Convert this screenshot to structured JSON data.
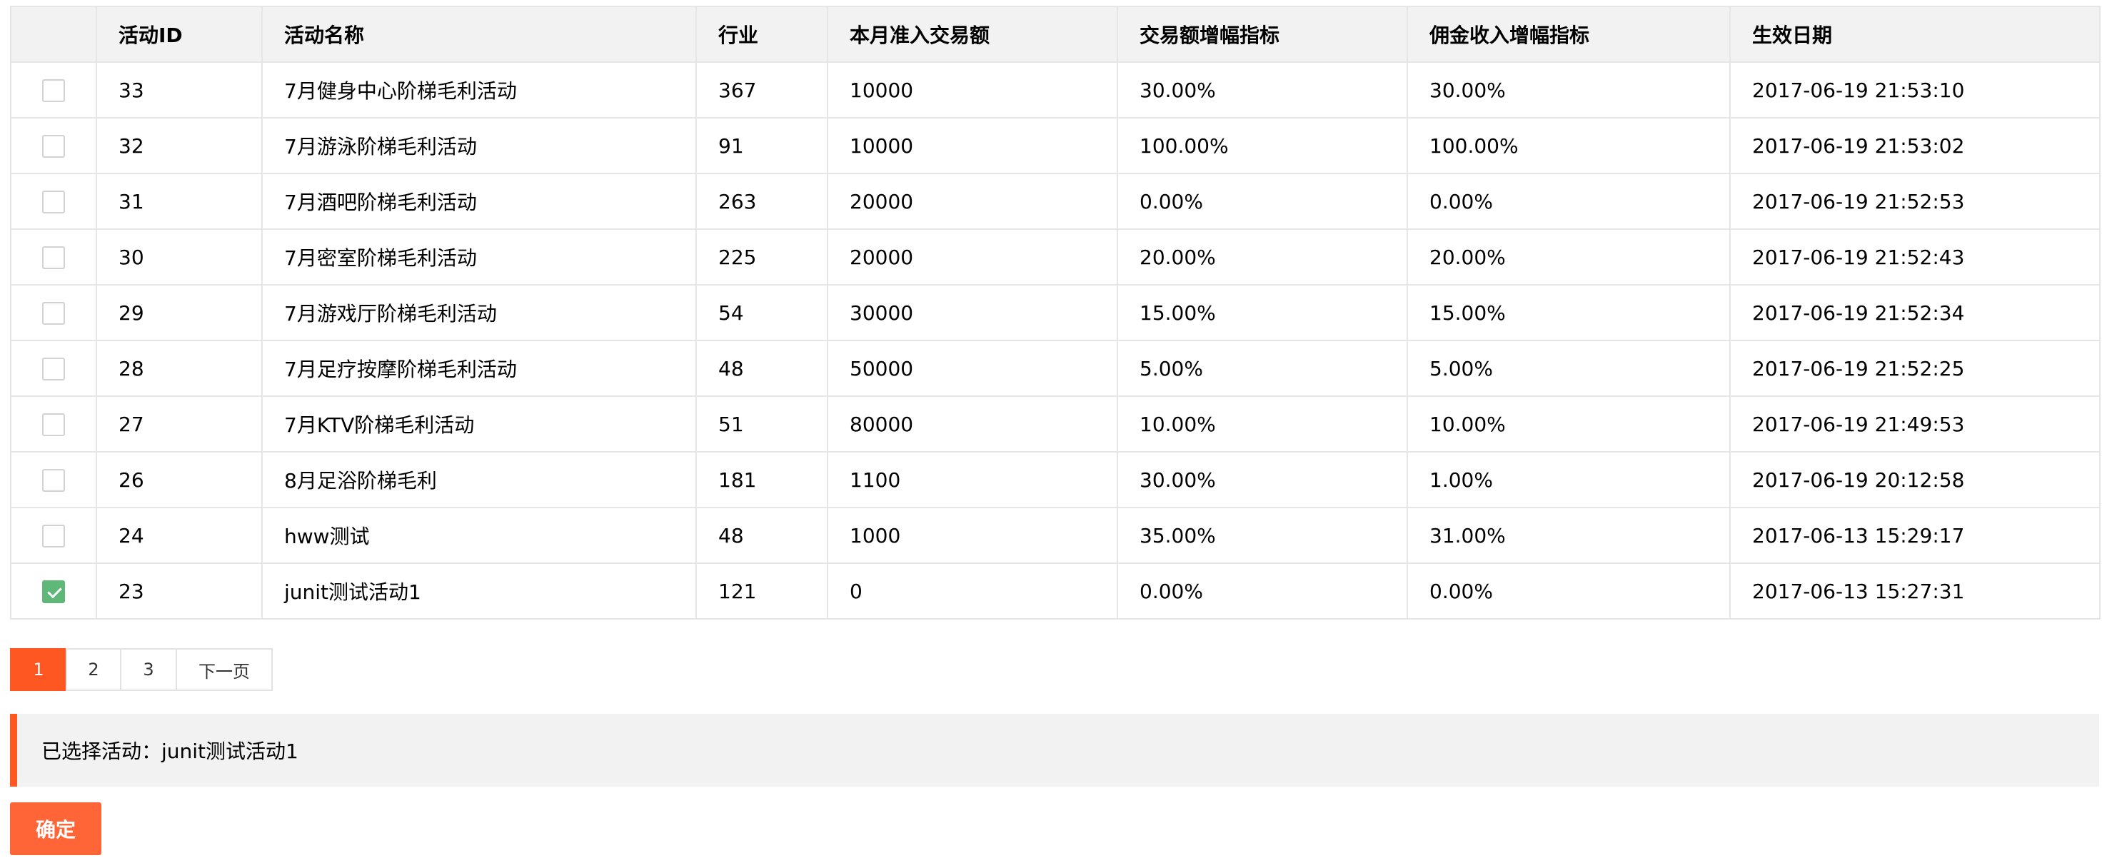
{
  "table": {
    "columns": [
      "活动ID",
      "活动名称",
      "行业",
      "本月准入交易额",
      "交易额增幅指标",
      "佣金收入增幅指标",
      "生效日期"
    ],
    "rows": [
      {
        "checked": false,
        "cells": [
          "33",
          "7月健身中心阶梯毛利活动",
          "367",
          "10000",
          "30.00%",
          "30.00%",
          "2017-06-19 21:53:10"
        ]
      },
      {
        "checked": false,
        "cells": [
          "32",
          "7月游泳阶梯毛利活动",
          "91",
          "10000",
          "100.00%",
          "100.00%",
          "2017-06-19 21:53:02"
        ]
      },
      {
        "checked": false,
        "cells": [
          "31",
          "7月酒吧阶梯毛利活动",
          "263",
          "20000",
          "0.00%",
          "0.00%",
          "2017-06-19 21:52:53"
        ]
      },
      {
        "checked": false,
        "cells": [
          "30",
          "7月密室阶梯毛利活动",
          "225",
          "20000",
          "20.00%",
          "20.00%",
          "2017-06-19 21:52:43"
        ]
      },
      {
        "checked": false,
        "cells": [
          "29",
          "7月游戏厅阶梯毛利活动",
          "54",
          "30000",
          "15.00%",
          "15.00%",
          "2017-06-19 21:52:34"
        ]
      },
      {
        "checked": false,
        "cells": [
          "28",
          "7月足疗按摩阶梯毛利活动",
          "48",
          "50000",
          "5.00%",
          "5.00%",
          "2017-06-19 21:52:25"
        ]
      },
      {
        "checked": false,
        "cells": [
          "27",
          "7月KTV阶梯毛利活动",
          "51",
          "80000",
          "10.00%",
          "10.00%",
          "2017-06-19 21:49:53"
        ]
      },
      {
        "checked": false,
        "cells": [
          "26",
          "8月足浴阶梯毛利",
          "181",
          "1100",
          "30.00%",
          "1.00%",
          "2017-06-19 20:12:58"
        ]
      },
      {
        "checked": false,
        "cells": [
          "24",
          "hww测试",
          "48",
          "1000",
          "35.00%",
          "31.00%",
          "2017-06-13 15:29:17"
        ]
      },
      {
        "checked": true,
        "cells": [
          "23",
          "junit测试活动1",
          "121",
          "0",
          "0.00%",
          "0.00%",
          "2017-06-13 15:27:31"
        ]
      }
    ]
  },
  "pagination": {
    "pages": [
      "1",
      "2",
      "3"
    ],
    "current": "1",
    "next_label": "下一页"
  },
  "selection": {
    "text": "已选择活动：junit测试活动1"
  },
  "confirm_label": "确定",
  "colors": {
    "accent": "#ff5722",
    "checked": "#5fb878",
    "header_bg": "#f2f2f2",
    "border": "#e6e6e6"
  },
  "icons": {
    "checkbox_checked": "check-icon"
  }
}
